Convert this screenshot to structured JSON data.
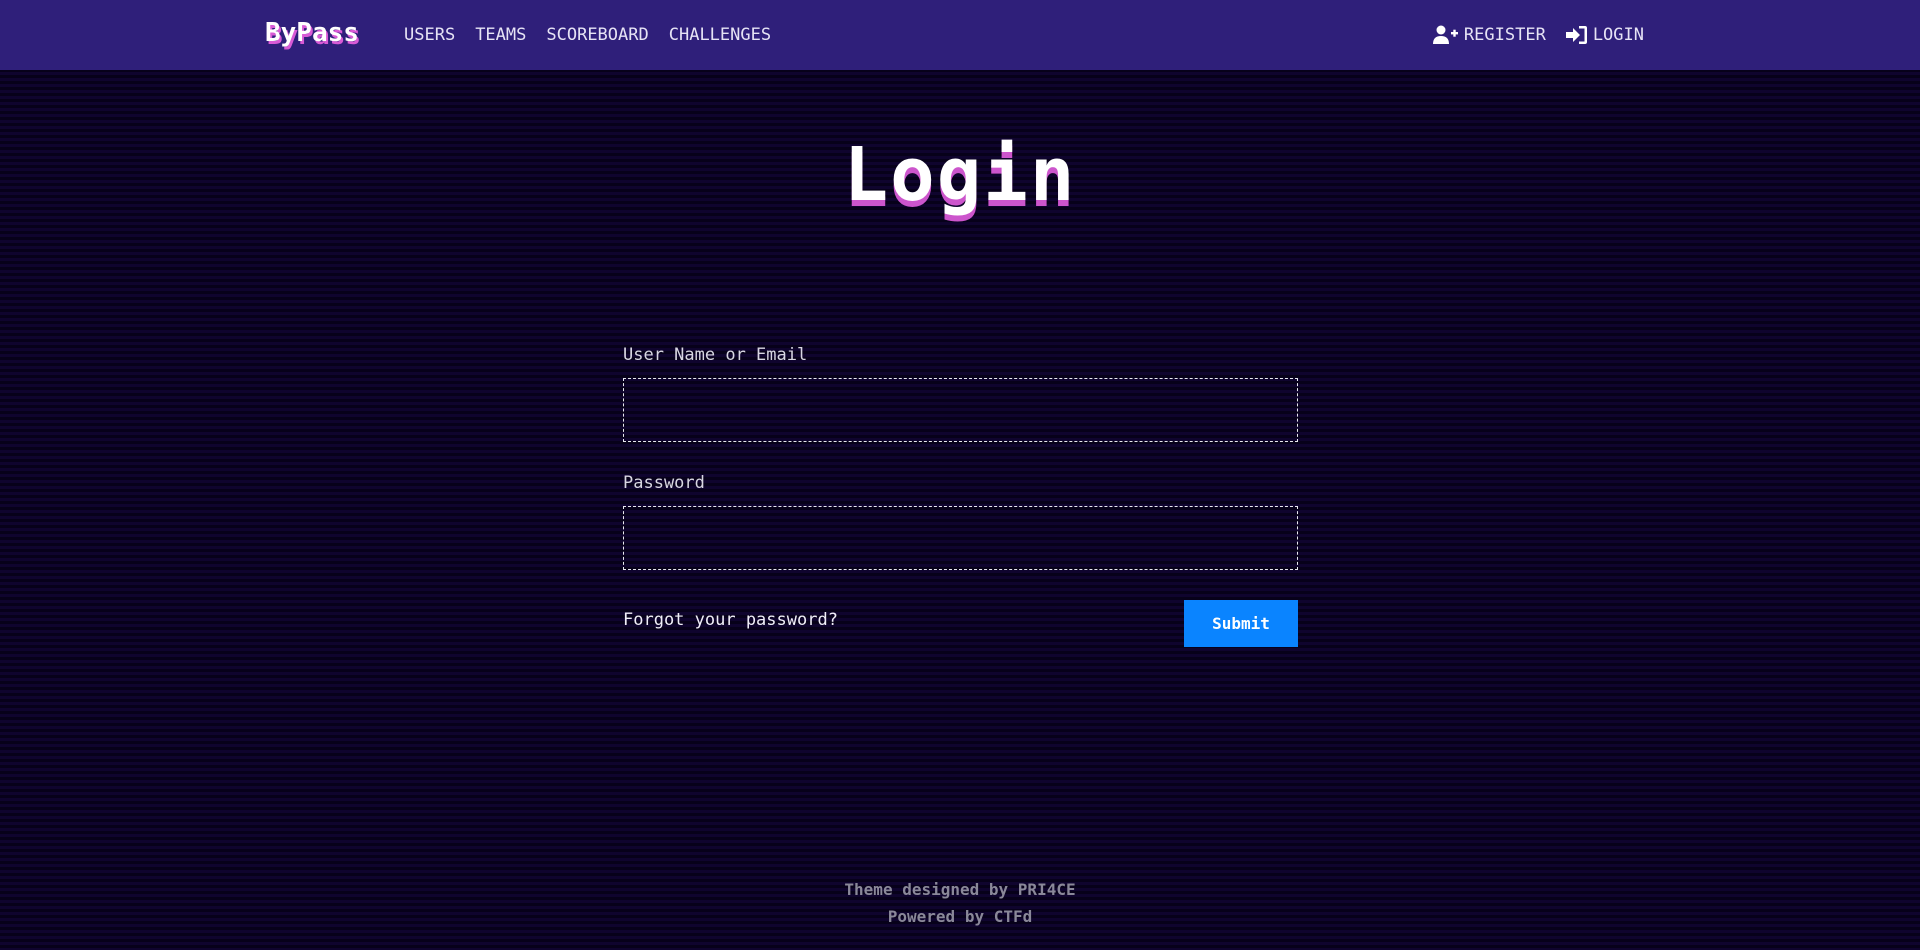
{
  "navbar": {
    "brand": "ByPass",
    "left_links": [
      {
        "label": "USERS"
      },
      {
        "label": "TEAMS"
      },
      {
        "label": "SCOREBOARD"
      },
      {
        "label": "CHALLENGES"
      }
    ],
    "right_links": [
      {
        "label": "REGISTER",
        "icon": "user-plus-icon"
      },
      {
        "label": "LOGIN",
        "icon": "sign-in-icon"
      }
    ]
  },
  "page": {
    "title": "Login"
  },
  "form": {
    "username_label": "User Name or Email",
    "username_value": "",
    "password_label": "Password",
    "password_value": "",
    "forgot_link": "Forgot your password?",
    "submit_label": "Submit"
  },
  "footer": {
    "theme_credit": "Theme designed by PRI4CE",
    "powered_by": "Powered by CTFd"
  },
  "colors": {
    "navbar_bg": "#2f1f7a",
    "page_bg": "#0a0221",
    "title_shadow": "#cc55cc",
    "submit_bg": "#0a84ff"
  }
}
